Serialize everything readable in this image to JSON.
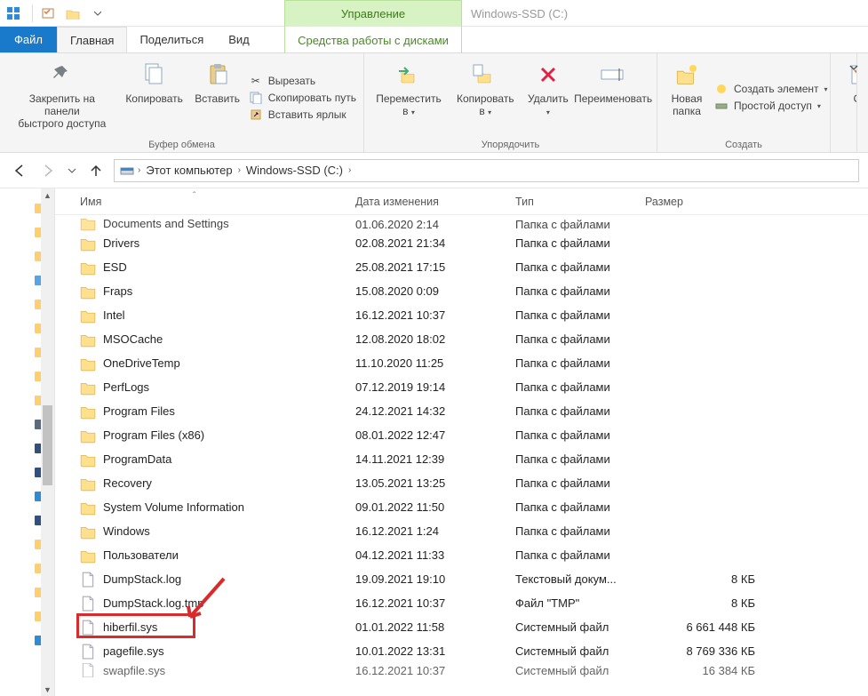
{
  "window_title": "Windows-SSD (C:)",
  "manage_tab": "Управление",
  "drive_tools": "Средства работы с дисками",
  "tabs": {
    "file": "Файл",
    "home": "Главная",
    "share": "Поделиться",
    "view": "Вид"
  },
  "ribbon": {
    "pin": "Закрепить на панели\nбыстрого доступа",
    "copy": "Копировать",
    "paste": "Вставить",
    "cut": "Вырезать",
    "copy_path": "Скопировать путь",
    "paste_shortcut": "Вставить ярлык",
    "clipboard_group": "Буфер обмена",
    "move_to": "Переместить в",
    "copy_to": "Копировать в",
    "delete": "Удалить",
    "rename": "Переименовать",
    "organize_group": "Упорядочить",
    "new_folder": "Новая папка",
    "new_item": "Создать элемент",
    "easy_access": "Простой доступ",
    "new_group": "Создать",
    "properties_partial": "Св"
  },
  "breadcrumb": {
    "root": "Этот компьютер",
    "drive": "Windows-SSD (C:)"
  },
  "columns": {
    "name": "Имя",
    "date": "Дата изменения",
    "type": "Тип",
    "size": "Размер"
  },
  "rows": [
    {
      "icon": "folder",
      "name": "Documents and Settings",
      "date": "01.06.2020 2:14",
      "type": "Папка с файлами",
      "size": "",
      "cut": true
    },
    {
      "icon": "folder",
      "name": "Drivers",
      "date": "02.08.2021 21:34",
      "type": "Папка с файлами",
      "size": ""
    },
    {
      "icon": "folder",
      "name": "ESD",
      "date": "25.08.2021 17:15",
      "type": "Папка с файлами",
      "size": ""
    },
    {
      "icon": "folder",
      "name": "Fraps",
      "date": "15.08.2020 0:09",
      "type": "Папка с файлами",
      "size": ""
    },
    {
      "icon": "folder",
      "name": "Intel",
      "date": "16.12.2021 10:37",
      "type": "Папка с файлами",
      "size": ""
    },
    {
      "icon": "folder",
      "name": "MSOCache",
      "date": "12.08.2020 18:02",
      "type": "Папка с файлами",
      "size": ""
    },
    {
      "icon": "folder",
      "name": "OneDriveTemp",
      "date": "11.10.2020 11:25",
      "type": "Папка с файлами",
      "size": ""
    },
    {
      "icon": "folder",
      "name": "PerfLogs",
      "date": "07.12.2019 19:14",
      "type": "Папка с файлами",
      "size": ""
    },
    {
      "icon": "folder",
      "name": "Program Files",
      "date": "24.12.2021 14:32",
      "type": "Папка с файлами",
      "size": ""
    },
    {
      "icon": "folder",
      "name": "Program Files (x86)",
      "date": "08.01.2022 12:47",
      "type": "Папка с файлами",
      "size": ""
    },
    {
      "icon": "folder",
      "name": "ProgramData",
      "date": "14.11.2021 12:39",
      "type": "Папка с файлами",
      "size": ""
    },
    {
      "icon": "folder",
      "name": "Recovery",
      "date": "13.05.2021 13:25",
      "type": "Папка с файлами",
      "size": ""
    },
    {
      "icon": "folder",
      "name": "System Volume Information",
      "date": "09.01.2022 11:50",
      "type": "Папка с файлами",
      "size": ""
    },
    {
      "icon": "folder",
      "name": "Windows",
      "date": "16.12.2021 1:24",
      "type": "Папка с файлами",
      "size": ""
    },
    {
      "icon": "folder",
      "name": "Пользователи",
      "date": "04.12.2021 11:33",
      "type": "Папка с файлами",
      "size": ""
    },
    {
      "icon": "file",
      "name": "DumpStack.log",
      "date": "19.09.2021 19:10",
      "type": "Текстовый докум...",
      "size": "8 КБ"
    },
    {
      "icon": "file",
      "name": "DumpStack.log.tmp",
      "date": "16.12.2021 10:37",
      "type": "Файл \"TMP\"",
      "size": "8 КБ"
    },
    {
      "icon": "file",
      "name": "hiberfil.sys",
      "date": "01.01.2022 11:58",
      "type": "Системный файл",
      "size": "6 661 448 КБ",
      "highlight": true
    },
    {
      "icon": "file",
      "name": "pagefile.sys",
      "date": "10.01.2022 13:31",
      "type": "Системный файл",
      "size": "8 769 336 КБ"
    },
    {
      "icon": "file",
      "name": "swapfile.sys",
      "date": "16.12.2021 10:37",
      "type": "Системный файл",
      "size": "16 384 КБ",
      "cutbot": true
    }
  ]
}
